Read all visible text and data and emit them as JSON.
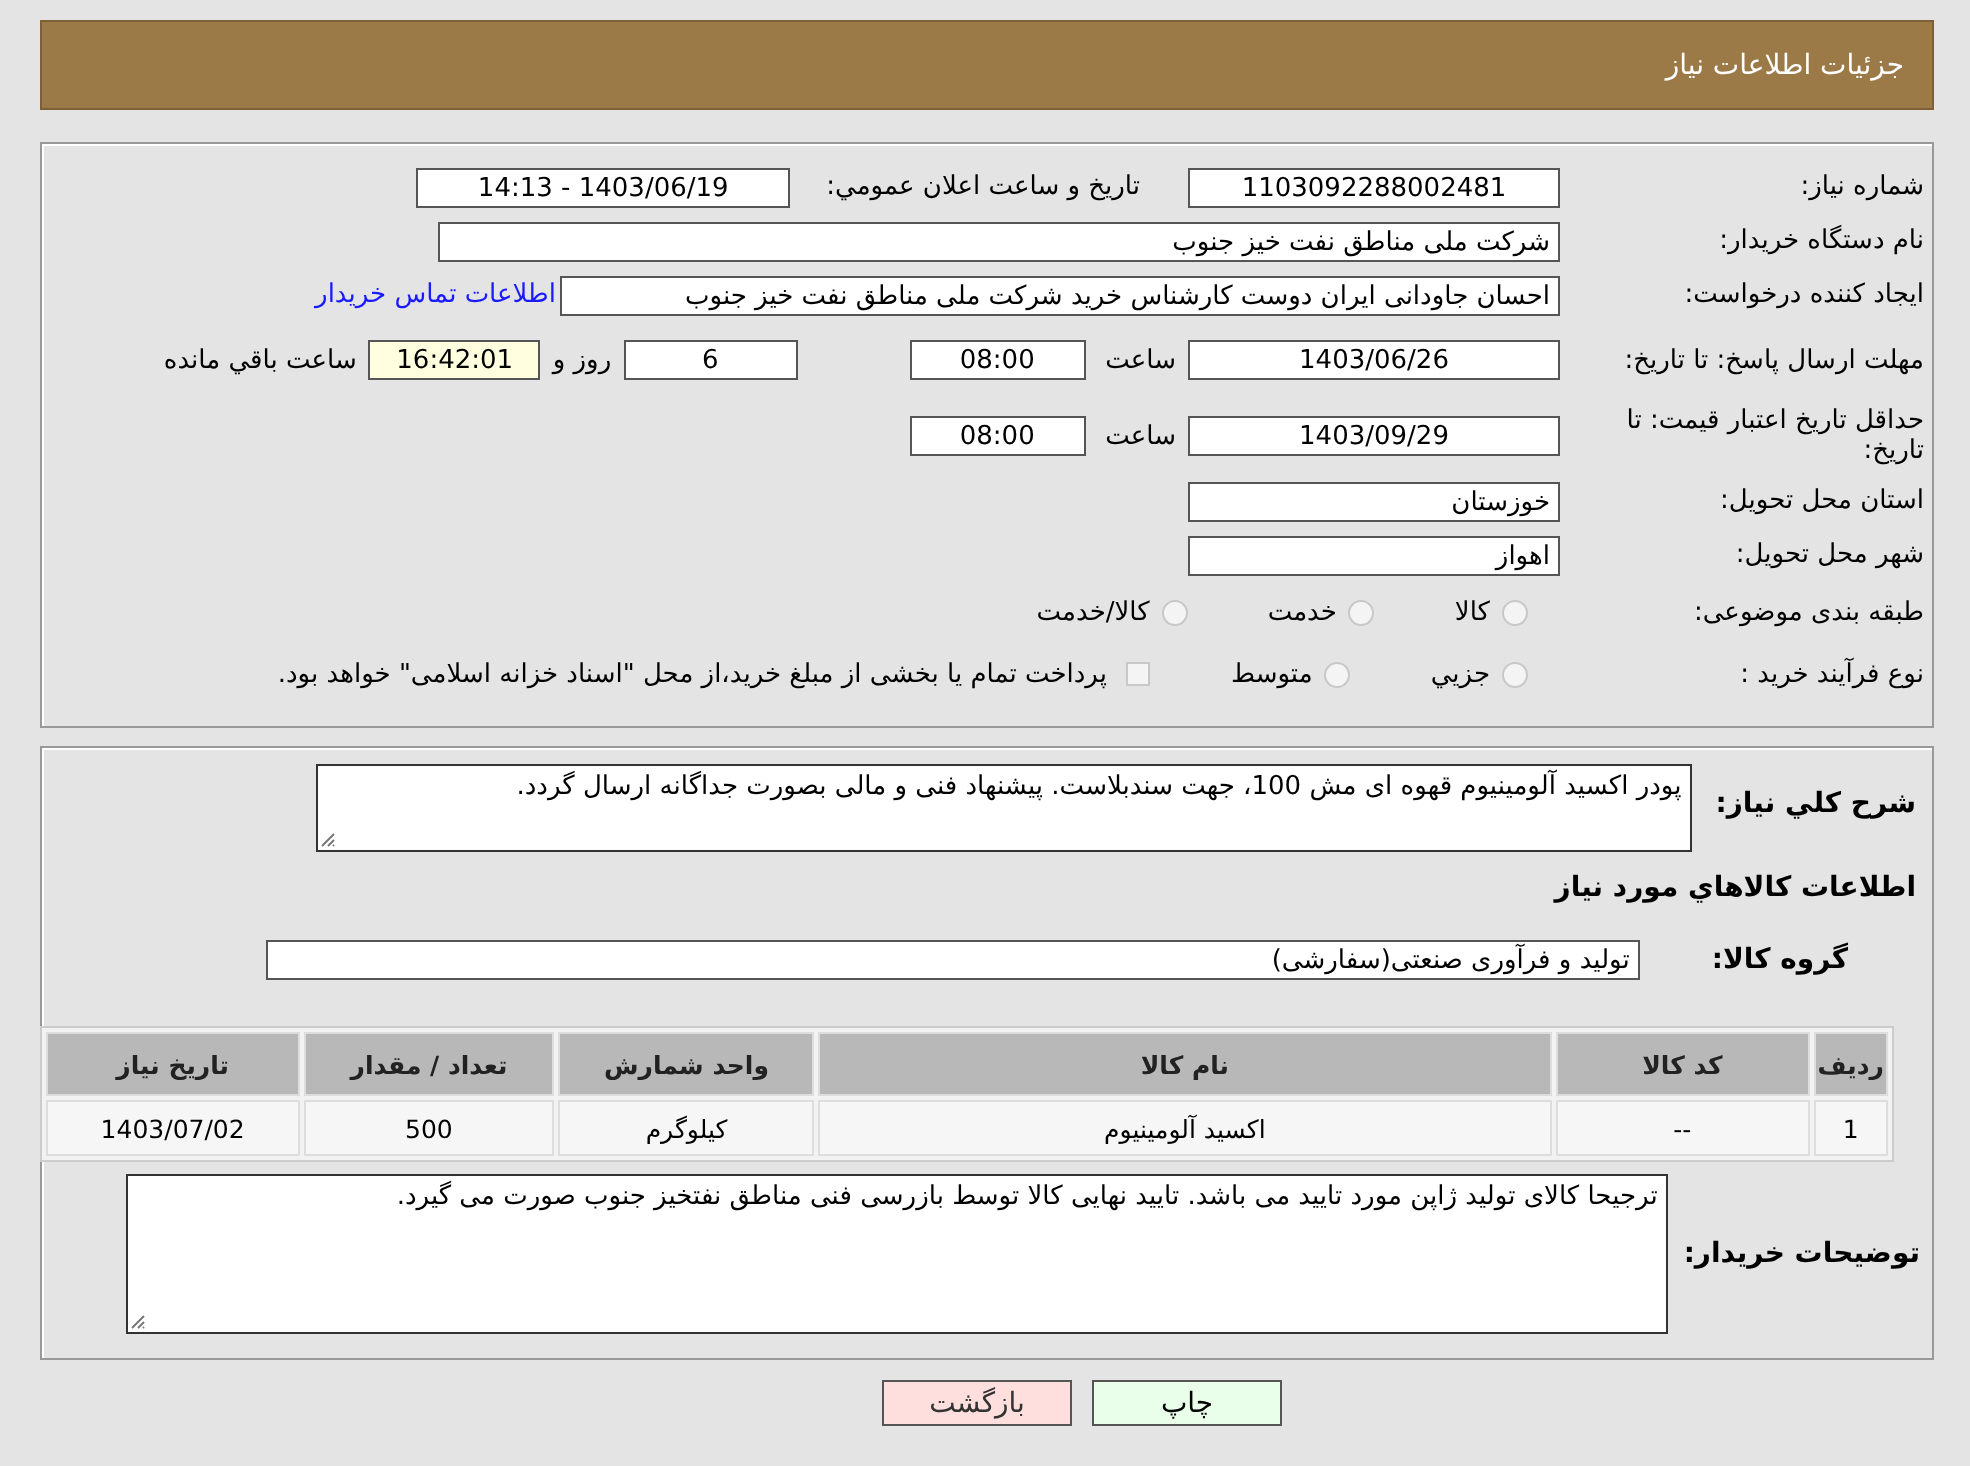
{
  "header": {
    "title": "جزئیات اطلاعات نیاز"
  },
  "request": {
    "number": {
      "label": "شماره نیاز:",
      "value": "1103092288002481"
    },
    "announce": {
      "label": "تاریخ و ساعت اعلان عمومي:",
      "value": "1403/06/19 - 14:13"
    },
    "buyer_org": {
      "label": "نام دستگاه خریدار:",
      "value": "شرکت ملی مناطق نفت خیز جنوب"
    },
    "requester": {
      "label": "ایجاد کننده درخواست:",
      "value": "احسان جاودانی ایران دوست کارشناس خرید شرکت ملی مناطق نفت خیز جنوب",
      "link": "اطلاعات تماس خریدار"
    },
    "reply_deadline": {
      "label": "مهلت ارسال پاسخ: تا تاریخ:",
      "date": "1403/06/26",
      "time_label": "ساعت",
      "time": "08:00",
      "days": "6",
      "days_label": "روز و",
      "remaining": "16:42:01",
      "remaining_label": "ساعت باقي مانده"
    },
    "price_validity": {
      "label": "حداقل تاریخ اعتبار قیمت: تا تاریخ:",
      "date": "1403/09/29",
      "time_label": "ساعت",
      "time": "08:00"
    },
    "province": {
      "label": "استان محل تحویل:",
      "value": "خوزستان"
    },
    "city": {
      "label": "شهر محل تحویل:",
      "value": "اهواز"
    },
    "category": {
      "label": "طبقه بندی موضوعی:",
      "options": [
        {
          "label": "کالا",
          "selected": false
        },
        {
          "label": "خدمت",
          "selected": false
        },
        {
          "label": "کالا/خدمت",
          "selected": false
        }
      ]
    },
    "purchase_type": {
      "label": "نوع فرآیند خرید :",
      "options": [
        {
          "label": "جزيي",
          "selected": false
        },
        {
          "label": "متوسط",
          "selected": false
        }
      ],
      "payment_note": {
        "text": "پرداخت تمام یا بخشی از مبلغ خرید،از محل \"اسناد خزانه اسلامی\" خواهد بود.",
        "checked": false
      }
    }
  },
  "details": {
    "description": {
      "label": "شرح کلي نياز:",
      "value": "پودر اکسید آلومینیوم قهوه ای مش 100، جهت سندبلاست. پیشنهاد فنی و مالی بصورت جداگانه ارسال گردد."
    },
    "items_heading": "اطلاعات کالاهاي مورد نياز",
    "group": {
      "label": "گروه کالا:",
      "value": "تولید و فرآوری صنعتی(سفارشی)"
    },
    "table": {
      "columns": [
        "ردیف",
        "کد کالا",
        "نام کالا",
        "واحد شمارش",
        "تعداد / مقدار",
        "تاریخ نیاز"
      ],
      "rows": [
        [
          "1",
          "--",
          "اکسید آلومینیوم",
          "کیلوگرم",
          "500",
          "1403/07/02"
        ]
      ]
    },
    "notes": {
      "label": "توضیحات خریدار:",
      "value": "ترجیحا کالای تولید ژاپن مورد تایید می باشد. تایید نهایی کالا توسط بازرسی فنی مناطق نفتخیز جنوب صورت می گیرد."
    }
  },
  "buttons": [
    {
      "label": "چاپ",
      "kind": "print"
    },
    {
      "label": "بازگشت",
      "kind": "back"
    }
  ]
}
